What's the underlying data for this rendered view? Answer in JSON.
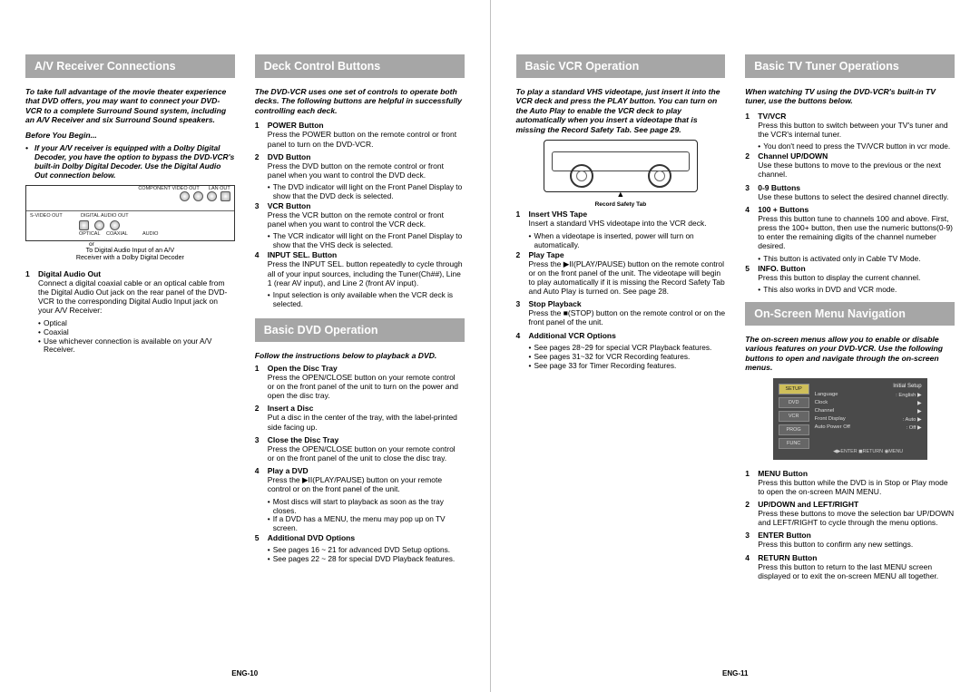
{
  "page_left_footer": "ENG-10",
  "page_right_footer": "ENG-11",
  "sections": {
    "av": {
      "title": "A/V Receiver Connections",
      "intro": "To take full advantage of the movie theater experience that DVD offers, you may want to connect your DVD-VCR to a complete Surround Sound system, including an A/V Receiver and six Surround Sound speakers.",
      "before": "Before You Begin...",
      "bypass": "If your A/V receiver is equipped with a Dolby Digital Decoder, you have the option to bypass the DVD-VCR's built-in Dolby Digital Decoder. Use the Digital Audio Out connection below.",
      "diag_top": {
        "a": "COMPONENT VIDEO OUT",
        "b": "LAN OUT"
      },
      "diag_labels": {
        "svideo": "S-VIDEO OUT",
        "da": "DIGITAL AUDIO OUT",
        "opt": "OPTICAL",
        "coax": "COAXIAL",
        "audio": "AUDIO"
      },
      "diag_or": "or",
      "diag_caption1": "To Digital Audio Input of an A/V",
      "diag_caption2": "Receiver with a Dolby Digital Decoder",
      "item1": {
        "n": "1",
        "title": "Digital Audio Out",
        "body": "Connect a digital coaxial cable or an optical cable from the Digital Audio Out jack on the rear panel of the DVD-VCR to the corresponding Digital Audio Input jack on your A/V Receiver:",
        "s1": "Optical",
        "s2": "Coaxial",
        "s3": "Use whichever connection is available on your A/V Receiver."
      }
    },
    "deck": {
      "title": "Deck Control Buttons",
      "intro": "The DVD-VCR uses one set of controls to operate both decks. The following buttons are helpful in successfully controlling each deck.",
      "items": [
        {
          "n": "1",
          "title": "POWER Button",
          "body": "Press the POWER button on the remote control or front panel to turn on the DVD-VCR."
        },
        {
          "n": "2",
          "title": "DVD Button",
          "body": "Press the DVD button on the remote control or front panel when you want to control the DVD deck.",
          "s": "The DVD indicator will light on the Front Panel Display to show that the DVD deck is selected."
        },
        {
          "n": "3",
          "title": "VCR Button",
          "body": "Press the VCR button on the remote control or front panel when you want to control the VCR deck.",
          "s": "The VCR indicator will light on the Front Panel Display to show that the VHS deck is selected."
        },
        {
          "n": "4",
          "title": "INPUT SEL. Button",
          "body": "Press the INPUT SEL. button repeatedly to cycle through all of your input sources, including the Tuner(Ch##), Line 1 (rear AV input), and Line 2 (front AV input).",
          "s": "Input selection is only available when the VCR deck is selected."
        }
      ]
    },
    "dvd": {
      "title": "Basic DVD Operation",
      "follow": "Follow the instructions below to playback a DVD.",
      "items": [
        {
          "n": "1",
          "title": "Open the Disc Tray",
          "body": "Press the OPEN/CLOSE button on your remote control or on the front panel of the unit to turn on the power and open the disc tray."
        },
        {
          "n": "2",
          "title": "Insert a Disc",
          "body": "Put a disc in the center of the tray, with the label-printed side facing up."
        },
        {
          "n": "3",
          "title": "Close the Disc Tray",
          "body": "Press the OPEN/CLOSE button on your remote control or on the front panel of the unit to close the disc tray."
        },
        {
          "n": "4",
          "title": "Play a DVD",
          "body": "Press the ▶II(PLAY/PAUSE) button on your remote control or on the front panel of the unit.",
          "s1": "Most discs will start to playback as soon as the tray closes.",
          "s2": "If a DVD has a MENU, the menu may pop up on TV screen."
        },
        {
          "n": "5",
          "title": "Additional DVD Options",
          "s1": "See pages 16 ~ 21 for advanced DVD Setup options.",
          "s2": "See pages 22 ~ 28 for special DVD Playback features."
        }
      ]
    },
    "vcr": {
      "title": "Basic VCR Operation",
      "intro": "To play a standard VHS videotape, just insert it into the VCR deck and press the PLAY button. You can turn on the Auto Play to enable the VCR deck to play automatically when you insert a videotape that is missing the Record Safety Tab. See page 29.",
      "vhs_caption": "Record Safety Tab",
      "items": [
        {
          "n": "1",
          "title": "Insert VHS Tape",
          "body": "Insert a standard VHS videotape into the VCR deck.",
          "s": "When a videotape is inserted, power will turn on automatically."
        },
        {
          "n": "2",
          "title": "Play Tape",
          "body": "Press the ▶II(PLAY/PAUSE) button on the remote control or on the front panel of the unit. The videotape will begin to play automatically if it is missing the Record Safety Tab and Auto Play is turned on. See page 28."
        },
        {
          "n": "3",
          "title": "Stop Playback",
          "body": "Press the ■(STOP) button on the remote control or on the front panel of the unit."
        },
        {
          "n": "4",
          "title": "Additional VCR Options",
          "s1": "See pages 28~29 for special VCR Playback features.",
          "s2": "See pages 31~32 for VCR Recording features.",
          "s3": "See page 33 for Timer Recording features."
        }
      ]
    },
    "tv": {
      "title": "Basic TV Tuner Operations",
      "intro": "When watching TV using the DVD-VCR's built-in TV tuner, use the buttons below.",
      "items": [
        {
          "n": "1",
          "title": "TV/VCR",
          "body": "Press this button to switch between your TV's tuner and the VCR's internal tuner.",
          "s": "You don't need to press the TV/VCR button in vcr mode."
        },
        {
          "n": "2",
          "title": "Channel UP/DOWN",
          "body": "Use these buttons to move to the previous or the next channel."
        },
        {
          "n": "3",
          "title": "0-9 Buttons",
          "body": "Use these buttons to select the desired channel directly."
        },
        {
          "n": "4",
          "title": "100 + Buttons",
          "body": "Press this button tune to channels 100 and above. First, press the 100+ button, then use the numeric buttons(0-9) to enter the remaining digits of the channel numeber desired.",
          "s": "This button is activated only in Cable TV Mode."
        },
        {
          "n": "5",
          "title": "INFO. Button",
          "body": "Press this button to display the current channel.",
          "s": "This also works in DVD and VCR mode."
        }
      ]
    },
    "menu": {
      "title": "On-Screen Menu Navigation",
      "intro": "The on-screen menus allow you to enable or disable various features on your DVD-VCR. Use the following buttons to open and navigate through the on-screen menus.",
      "osd": {
        "header": "Initial Setup",
        "left": [
          "SETUP",
          "DVD",
          "VCR",
          "PROG",
          "FUNC"
        ],
        "right": [
          {
            "k": "Language",
            "v": ": English"
          },
          {
            "k": "Clock",
            "v": ""
          },
          {
            "k": "Channel",
            "v": ""
          },
          {
            "k": "Front Display",
            "v": ": Auto"
          },
          {
            "k": "Auto Power Off",
            "v": ": Off"
          }
        ],
        "footer": "◀▶ENTER  ◼RETURN  ◉MENU"
      },
      "items": [
        {
          "n": "1",
          "title": "MENU Button",
          "body": "Press this button while the DVD is in Stop or Play mode to open the on-screen MAIN MENU."
        },
        {
          "n": "2",
          "title": "UP/DOWN and LEFT/RIGHT",
          "body": "Press these buttons to move the selection bar UP/DOWN and LEFT/RIGHT to cycle through the menu options."
        },
        {
          "n": "3",
          "title": "ENTER  Button",
          "body": "Press this button to confirm any new settings."
        },
        {
          "n": "4",
          "title": "RETURN Button",
          "body": "Press this button to return to the last MENU screen displayed or to exit the on-screen MENU all together."
        }
      ]
    }
  }
}
